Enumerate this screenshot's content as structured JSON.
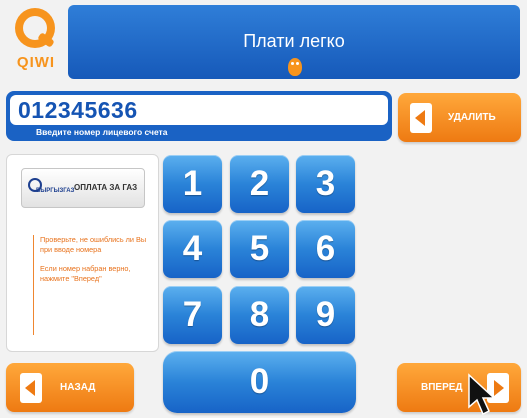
{
  "brand": {
    "logo_text": "QIWI",
    "color": "#f7941d"
  },
  "header": {
    "title": "Плати легко",
    "background": "#1f6bd0"
  },
  "account": {
    "value": "012345636",
    "hint": "Введите номер лицевого счета"
  },
  "buttons": {
    "delete": "УДАЛИТЬ",
    "back": "НАЗАД",
    "forward": "ВПЕРЕД"
  },
  "service": {
    "logo_text": "ВЫРГЫЗГАЗ",
    "label": "ОПЛАТА ЗА ГАЗ"
  },
  "info": {
    "line1": "Проверьте, не ошиблись ли Вы при вводе номера",
    "line2": "Если номер набран верно, нажмите \"Вперед\""
  },
  "keypad": {
    "k1": "1",
    "k2": "2",
    "k3": "3",
    "k4": "4",
    "k5": "5",
    "k6": "6",
    "k7": "7",
    "k8": "8",
    "k9": "9",
    "k0": "0"
  },
  "colors": {
    "accent_blue": "#1a62c4",
    "accent_orange": "#f58a1f",
    "hint_text": "#e8721c"
  }
}
